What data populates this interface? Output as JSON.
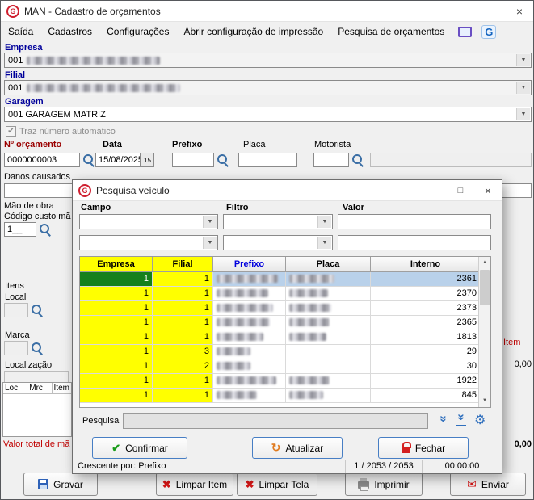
{
  "window": {
    "title": "MAN - Cadastro de orçamentos",
    "menu": [
      "Saída",
      "Cadastros",
      "Configurações",
      "Abrir configuração de impressão",
      "Pesquisa de orçamentos"
    ]
  },
  "form": {
    "empresa": {
      "label": "Empresa",
      "code": "001"
    },
    "filial": {
      "label": "Filial",
      "code": "001"
    },
    "garagem": {
      "label": "Garagem",
      "value": "001 GARAGEM MATRIZ"
    },
    "auto_number_checkbox": "Traz número automático",
    "orcamento": {
      "label": "Nº orçamento",
      "value": "0000000003"
    },
    "data": {
      "label": "Data",
      "value": "15/08/2025",
      "button": "15"
    },
    "prefixo_label": "Prefixo",
    "placa_label": "Placa",
    "motorista_label": "Motorista",
    "danos_label": "Danos causados",
    "mao_de_obra_label": "Mão de obra",
    "codigo_custo_label": "Código custo mã",
    "codigo_custo_value": "1__",
    "itens_label": "Itens",
    "local_label": "Local",
    "marca_label": "Marca",
    "localizacao_label": "Localização",
    "mini_grid_headers": [
      "Loc",
      "Mrc",
      "Item"
    ],
    "valor_total_label": "Valor total de mã",
    "right_fragments": {
      "item": "Item",
      "value_mid": "0,00",
      "value_bottom": "0,00"
    }
  },
  "actions": {
    "gravar": "Gravar",
    "limpar_item": "Limpar Item",
    "limpar_tela": "Limpar Tela",
    "imprimir": "Imprimir",
    "enviar": "Enviar"
  },
  "dialog": {
    "title": "Pesquisa veículo",
    "campo_label": "Campo",
    "filtro_label": "Filtro",
    "valor_label": "Valor",
    "table": {
      "headers": [
        "Empresa",
        "Filial",
        "Prefixo",
        "Placa",
        "Interno"
      ],
      "rows": [
        {
          "empresa": "1",
          "filial": "1",
          "interno": "2361"
        },
        {
          "empresa": "1",
          "filial": "1",
          "interno": "2370"
        },
        {
          "empresa": "1",
          "filial": "1",
          "interno": "2373"
        },
        {
          "empresa": "1",
          "filial": "1",
          "interno": "2365"
        },
        {
          "empresa": "1",
          "filial": "1",
          "interno": "1813"
        },
        {
          "empresa": "1",
          "filial": "3",
          "interno": "29"
        },
        {
          "empresa": "1",
          "filial": "2",
          "interno": "30"
        },
        {
          "empresa": "1",
          "filial": "1",
          "interno": "1922"
        },
        {
          "empresa": "1",
          "filial": "1",
          "interno": "845"
        }
      ]
    },
    "pesquisa_label": "Pesquisa",
    "buttons": {
      "confirmar": "Confirmar",
      "atualizar": "Atualizar",
      "fechar": "Fechar"
    },
    "status": {
      "sort": "Crescente por: Prefixo",
      "counter": "1 / 2053 / 2053",
      "timer": "00:00:00"
    }
  }
}
